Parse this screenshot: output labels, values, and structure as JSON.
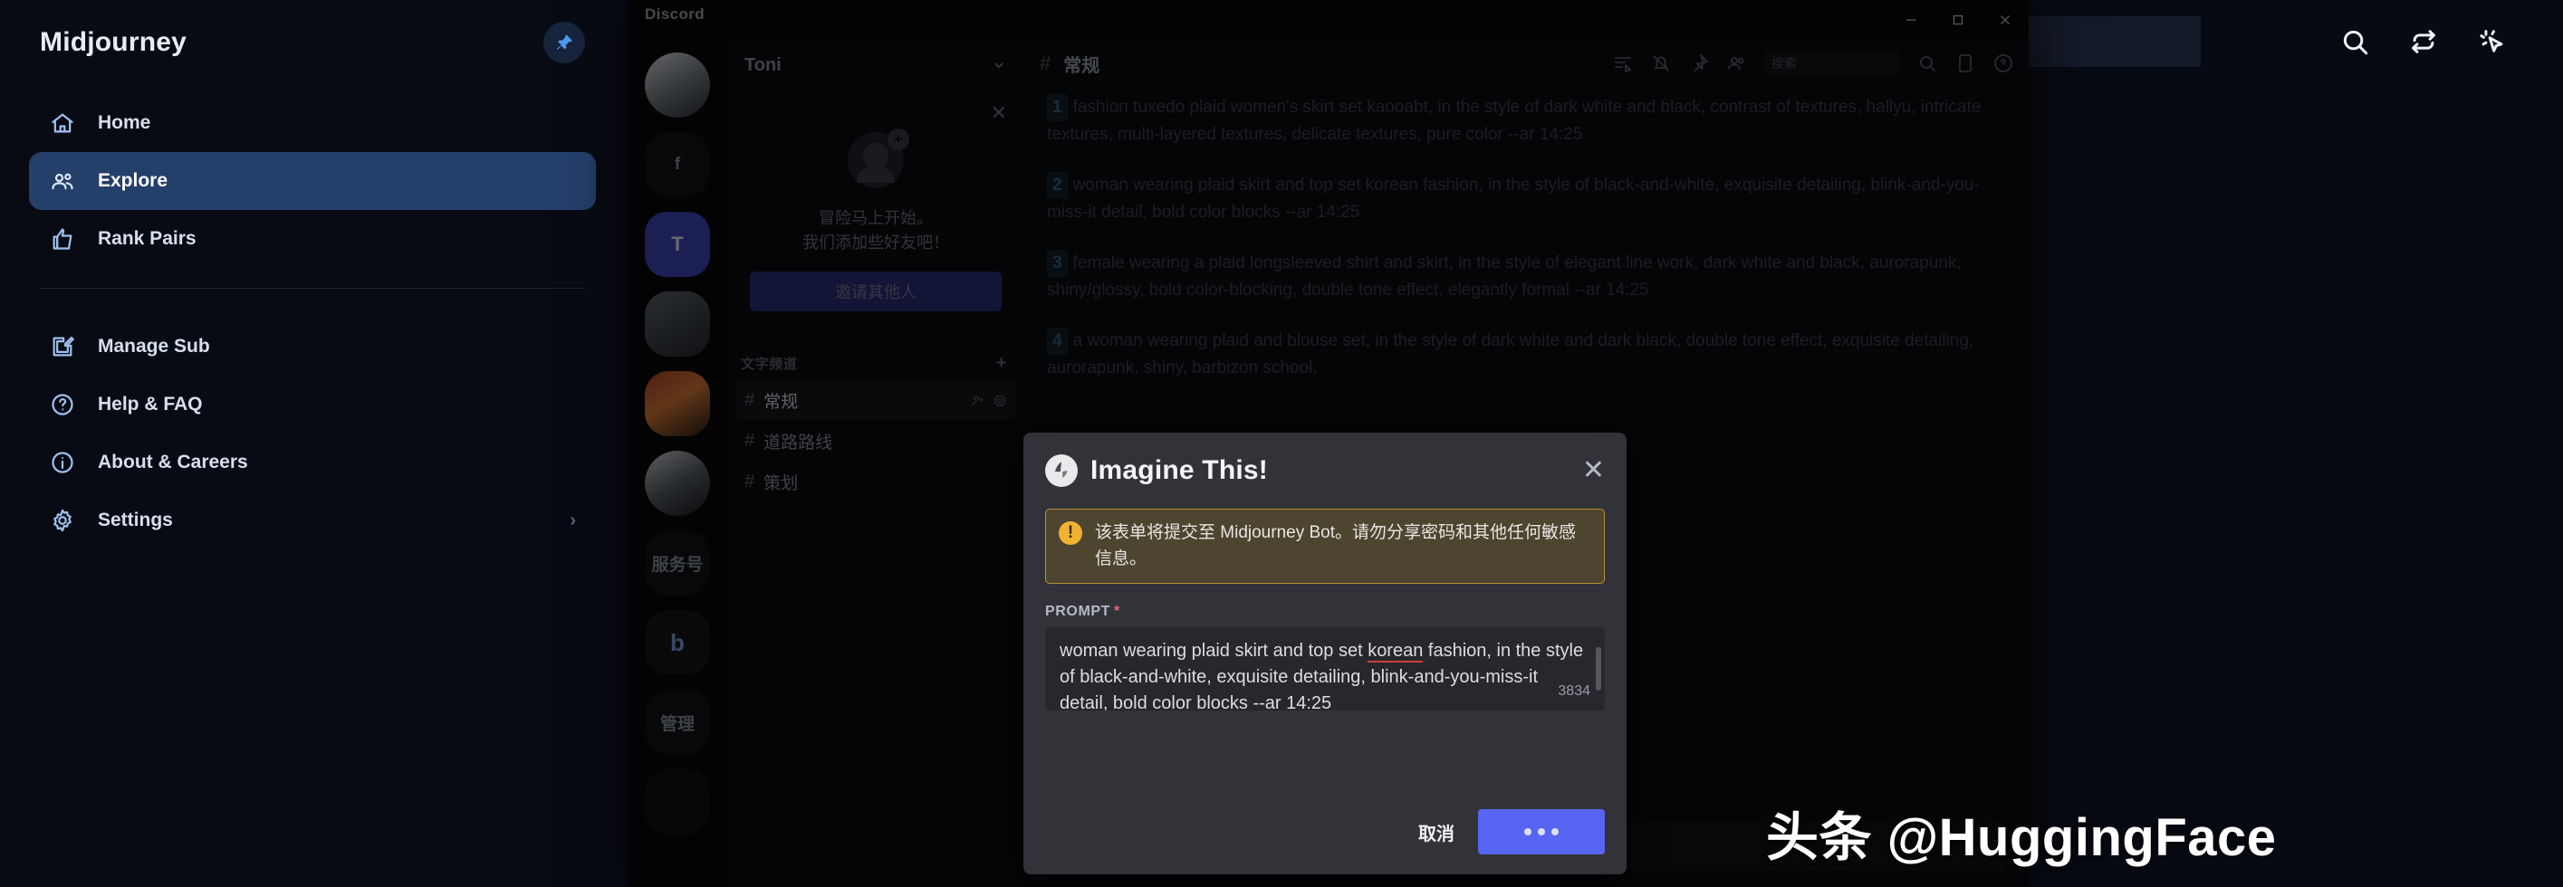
{
  "midjourney": {
    "brand": "Midjourney",
    "pin_icon": "pin-icon",
    "nav": [
      {
        "label": "Home",
        "icon": "home-icon",
        "active": false
      },
      {
        "label": "Explore",
        "icon": "people-icon",
        "active": true
      },
      {
        "label": "Rank Pairs",
        "icon": "thumbs-up-icon",
        "active": false
      }
    ],
    "nav_secondary": [
      {
        "label": "Manage Sub",
        "icon": "edit-square-icon",
        "chevron": ""
      },
      {
        "label": "Help & FAQ",
        "icon": "question-circle-icon",
        "chevron": ""
      },
      {
        "label": "About & Careers",
        "icon": "info-circle-icon",
        "chevron": ""
      },
      {
        "label": "Settings",
        "icon": "gear-icon",
        "chevron": "›"
      }
    ],
    "toolbar": [
      {
        "name": "search-icon"
      },
      {
        "name": "refresh-icon"
      },
      {
        "name": "cursor-sparkle-icon"
      }
    ]
  },
  "discord": {
    "window_title": "Discord",
    "window_controls": {
      "minimize": "minimize-icon",
      "maximize": "maximize-icon",
      "close": "close-icon"
    },
    "server_name": "Toni",
    "servers": [
      {
        "label": "",
        "kind": "pic1"
      },
      {
        "label": "f",
        "kind": "txt"
      },
      {
        "label": "T",
        "kind": "sel"
      },
      {
        "label": "",
        "kind": "pic2"
      },
      {
        "label": "",
        "kind": "pic3"
      },
      {
        "label": "",
        "kind": "pic4"
      },
      {
        "label": "服务号",
        "kind": "mg"
      },
      {
        "label": "b",
        "kind": "b"
      },
      {
        "label": "管理",
        "kind": "mg"
      },
      {
        "label": "",
        "kind": "dim"
      }
    ],
    "invite_card": {
      "line1": "冒险马上开始。",
      "line2": "我们添加些好友吧！",
      "button": "邀请其他人",
      "close_icon": "close-icon"
    },
    "category": {
      "label": "文字频道",
      "add_icon": "plus-icon"
    },
    "channels": [
      {
        "name": "常规",
        "active": true
      },
      {
        "name": "道路路线",
        "active": false
      },
      {
        "name": "策划",
        "active": false
      }
    ],
    "channel_header": {
      "hash": "#",
      "name": "常规",
      "search_placeholder": "搜索",
      "icons": [
        "threads-icon",
        "bell-off-icon",
        "pin-icon",
        "members-icon",
        "inbox-icon",
        "help-icon"
      ]
    },
    "messages": [
      {
        "num": "1",
        "text": "fashion tuxedo plaid women's skirt set kaooabt, in the style of dark white and black, contrast of textures, hallyu, intricate textures, multi-layered textures, delicate textures, pure color --ar 14:25"
      },
      {
        "num": "2",
        "text": "woman wearing plaid skirt and top set korean fashion, in the style of black-and-white, exquisite detailing, blink-and-you-miss-it detail, bold color blocks --ar 14:25"
      },
      {
        "num": "3",
        "text": "female wearing a plaid longsleeved shirt and skirt, in the style of elegant line work, dark white and black, aurorapunk, shiny/glossy, bold color-blocking, double tone effect, elegantly formal --ar 14:25"
      },
      {
        "num": "4",
        "text": "a woman wearing plaid and blouse set, in the style of dark white and dark black, double tone effect, exquisite detailing, aurorapunk, shiny, barbizon school,"
      }
    ],
    "modal": {
      "title": "Imagine This!",
      "avatar_icon": "midjourney-bot-avatar",
      "close_icon": "close-icon",
      "warning_icon": "warning-icon",
      "warning_text": "该表单将提交至 Midjourney Bot。请勿分享密码和其他任何敏感信息。",
      "field_label": "PROMPT",
      "required_mark": "*",
      "prompt_part1": "woman wearing plaid skirt and top set ",
      "prompt_misspelled": "korean",
      "prompt_part2": " fashion, in the style of black-and-white, exquisite detailing, blink-and-you-miss-it detail, bold color blocks --ar 14:25",
      "char_counter": "3834",
      "cancel_label": "取消",
      "submit_label": "•••"
    }
  },
  "watermark": "头条 @HuggingFace",
  "colors": {
    "accent_blurple": "#5865f2",
    "mj_active": "#253f6b",
    "warning_amber": "#f0b232"
  }
}
